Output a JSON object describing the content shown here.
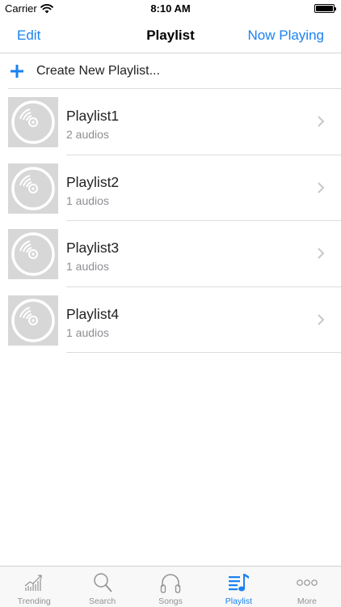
{
  "status_bar": {
    "carrier": "Carrier",
    "time": "8:10 AM"
  },
  "nav": {
    "left_label": "Edit",
    "title": "Playlist",
    "right_label": "Now Playing"
  },
  "create": {
    "label": "Create New Playlist..."
  },
  "playlists": [
    {
      "name": "Playlist1",
      "count": "2 audios"
    },
    {
      "name": "Playlist2",
      "count": "1 audios"
    },
    {
      "name": "Playlist3",
      "count": "1 audios"
    },
    {
      "name": "Playlist4",
      "count": "1 audios"
    }
  ],
  "tabs": [
    {
      "label": "Trending",
      "icon": "trending-icon"
    },
    {
      "label": "Search",
      "icon": "search-icon"
    },
    {
      "label": "Songs",
      "icon": "headphones-icon"
    },
    {
      "label": "Playlist",
      "icon": "playlist-icon",
      "active": true
    },
    {
      "label": "More",
      "icon": "more-icon"
    }
  ],
  "colors": {
    "accent": "#1a82f0",
    "inactive_tab": "#929292",
    "subtitle": "#8e8e93",
    "thumbnail_bg": "#d7d7d7"
  }
}
